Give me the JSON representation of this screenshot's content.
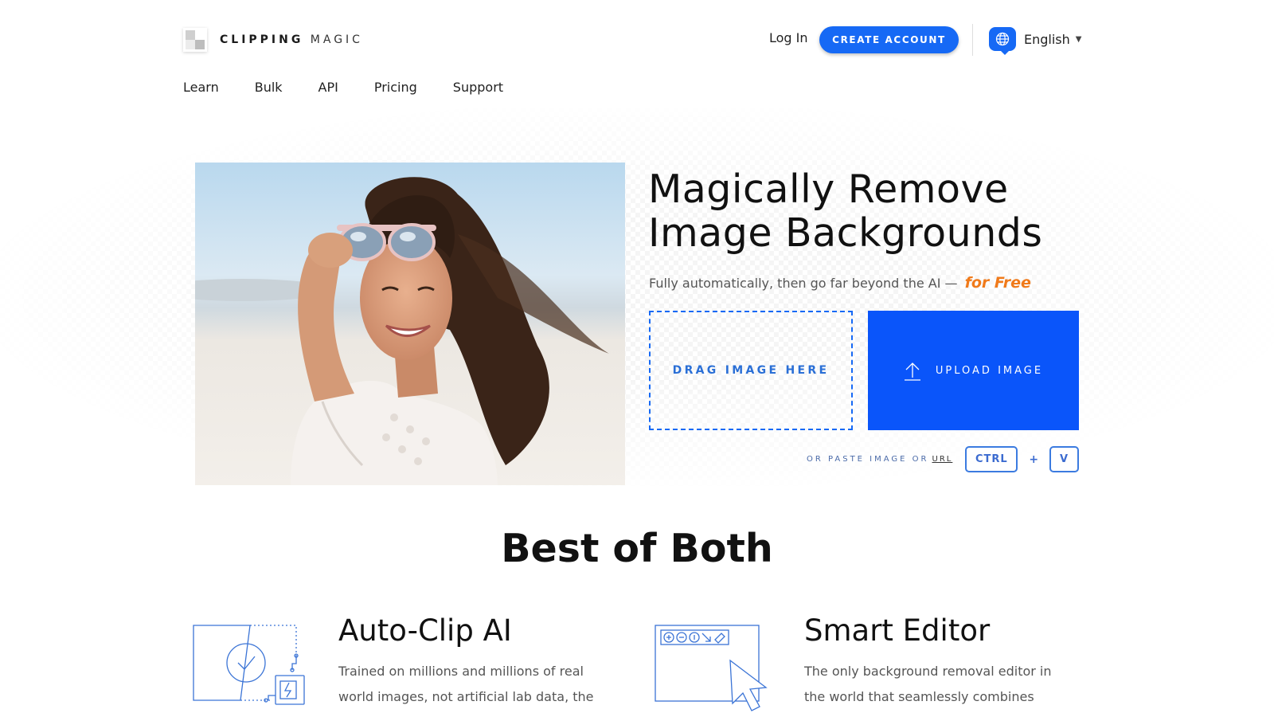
{
  "header": {
    "logo_bold": "CLIPPING",
    "logo_light": "MAGIC",
    "login": "Log In",
    "create_account": "CREATE ACCOUNT",
    "language": "English"
  },
  "nav": {
    "items": [
      "Learn",
      "Bulk",
      "API",
      "Pricing",
      "Support"
    ]
  },
  "hero": {
    "headline_line1": "Magically Remove",
    "headline_line2": "Image Backgrounds",
    "subline": "Fully automatically, then go far beyond the AI —",
    "subline_emphasis": "for Free",
    "drop_zone": "DRAG IMAGE HERE",
    "upload_button": "UPLOAD IMAGE",
    "paste_text": "OR PASTE IMAGE OR",
    "paste_url": "URL",
    "key_ctrl": "CTRL",
    "key_plus": "+",
    "key_v": "V"
  },
  "section": {
    "title": "Best of Both"
  },
  "features": [
    {
      "title": "Auto-Clip AI",
      "desc": "Trained on millions and millions of real world images, not artificial lab data, the"
    },
    {
      "title": "Smart Editor",
      "desc": "The only background removal editor in the world that seamlessly combines"
    }
  ],
  "colors": {
    "accent": "#1669f5",
    "upload": "#0a55fa",
    "free": "#f07a1a"
  }
}
